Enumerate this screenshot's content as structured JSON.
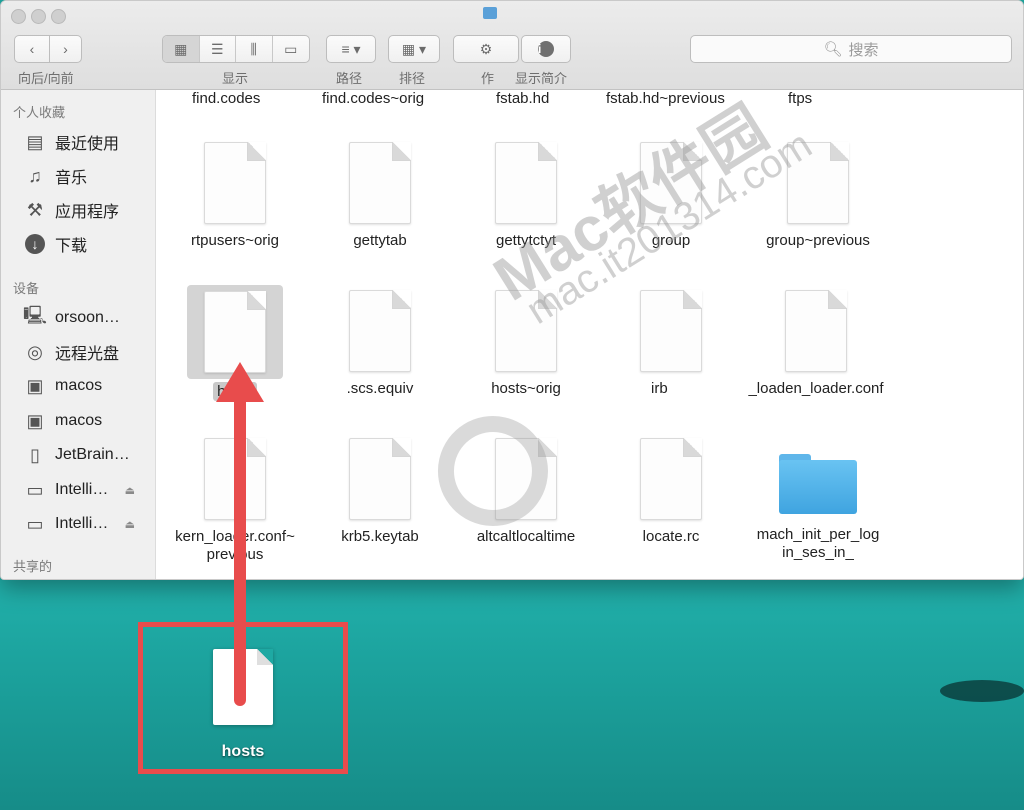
{
  "toolbar": {
    "nav_label": "向后/向前",
    "view_label": "显示",
    "path_label": "路径",
    "arrange_label": "排径",
    "action_label": "作",
    "info_label": "显示简介",
    "search_placeholder": "搜索"
  },
  "sidebar": {
    "favorites_heading": "个人收藏",
    "favorites": [
      {
        "label": "最近使用",
        "icon": "recents-icon"
      },
      {
        "label": "音乐",
        "icon": "music-icon"
      },
      {
        "label": "应用程序",
        "icon": "applications-icon"
      },
      {
        "label": "下载",
        "icon": "downloads-icon"
      }
    ],
    "devices_heading": "设备",
    "devices": [
      {
        "label": "orsoon…",
        "icon": "computer-icon"
      },
      {
        "label": "远程光盘",
        "icon": "disc-icon"
      },
      {
        "label": "macos",
        "icon": "disk-icon"
      },
      {
        "label": "macos",
        "icon": "disk-icon"
      },
      {
        "label": "JetBrain…",
        "icon": "document-icon"
      },
      {
        "label": "Intelli…",
        "icon": "drive-icon"
      },
      {
        "label": "Intelli…",
        "icon": "drive-icon"
      }
    ],
    "shared_heading": "共享的"
  },
  "files": {
    "row0": [
      "find.codes",
      "find.codes~orig",
      "fstab.hd",
      "fstab.hd~previous",
      "ftps"
    ],
    "row1": [
      "rtpusers~orig",
      "gettytab",
      "gettytctyt",
      "group",
      "group~previous"
    ],
    "row2": [
      "hosts",
      ".scs.equiv",
      "hosts~orig",
      "irb",
      "_loaden_loader.conf"
    ],
    "row3": [
      "kern_loader.conf~\nprevious",
      "krb5.keytab",
      "altcaltlocaltime",
      "locate.rc",
      "mach_init_per_log\nin_ses_in_"
    ]
  },
  "watermark": {
    "brand": "Mac软件园",
    "url": "mac.it201314.com"
  },
  "desktop": {
    "file_label": "hosts"
  },
  "colors": {
    "accent": "#e84c4c",
    "folder": "#4fb3ea"
  }
}
